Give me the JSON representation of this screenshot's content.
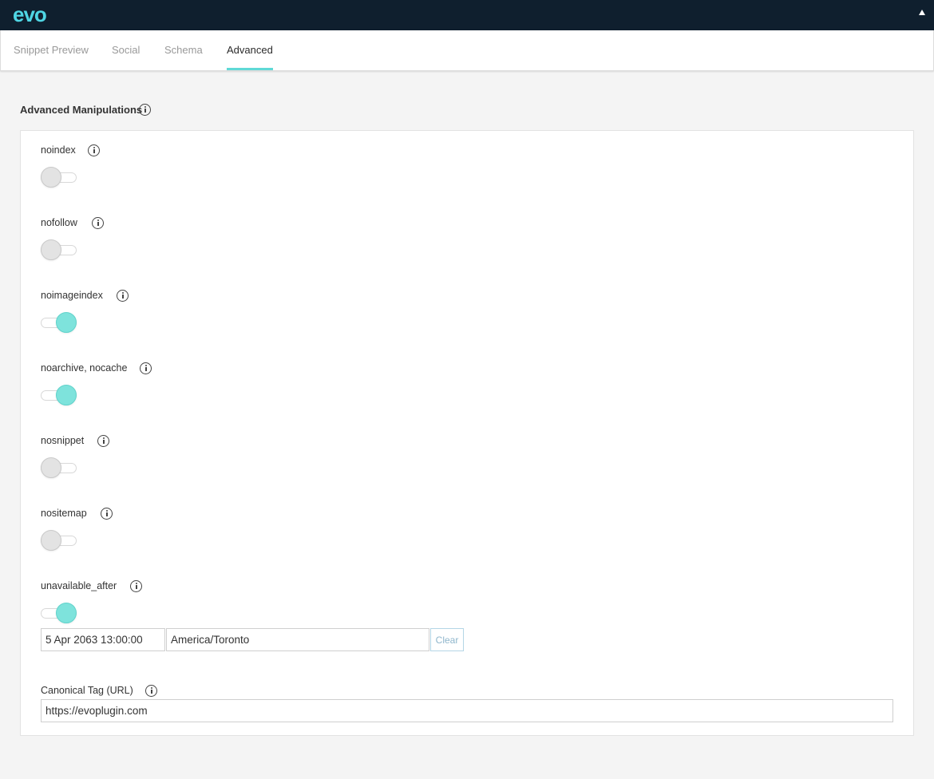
{
  "app": {
    "logo_text": "evo"
  },
  "tabs": [
    {
      "label": "Snippet Preview",
      "active": false
    },
    {
      "label": "Social",
      "active": false
    },
    {
      "label": "Schema",
      "active": false
    },
    {
      "label": "Advanced",
      "active": true
    }
  ],
  "section": {
    "title": "Advanced Manipulations"
  },
  "options": [
    {
      "label": "noindex",
      "enabled": false
    },
    {
      "label": "nofollow",
      "enabled": false
    },
    {
      "label": "noimageindex",
      "enabled": true
    },
    {
      "label": "noarchive, nocache",
      "enabled": true
    },
    {
      "label": "nosnippet",
      "enabled": false
    },
    {
      "label": "nositemap",
      "enabled": false
    },
    {
      "label": "unavailable_after",
      "enabled": true
    }
  ],
  "unavailable_after": {
    "date": "5 Apr 2063 13:00:00",
    "timezone": "America/Toronto",
    "clear_label": "Clear"
  },
  "canonical": {
    "label": "Canonical Tag (URL)",
    "value": "https://evoplugin.com"
  },
  "colors": {
    "accent": "#5fd9d6",
    "topbar": "#0f1f2e",
    "logo": "#4fd6e4"
  }
}
